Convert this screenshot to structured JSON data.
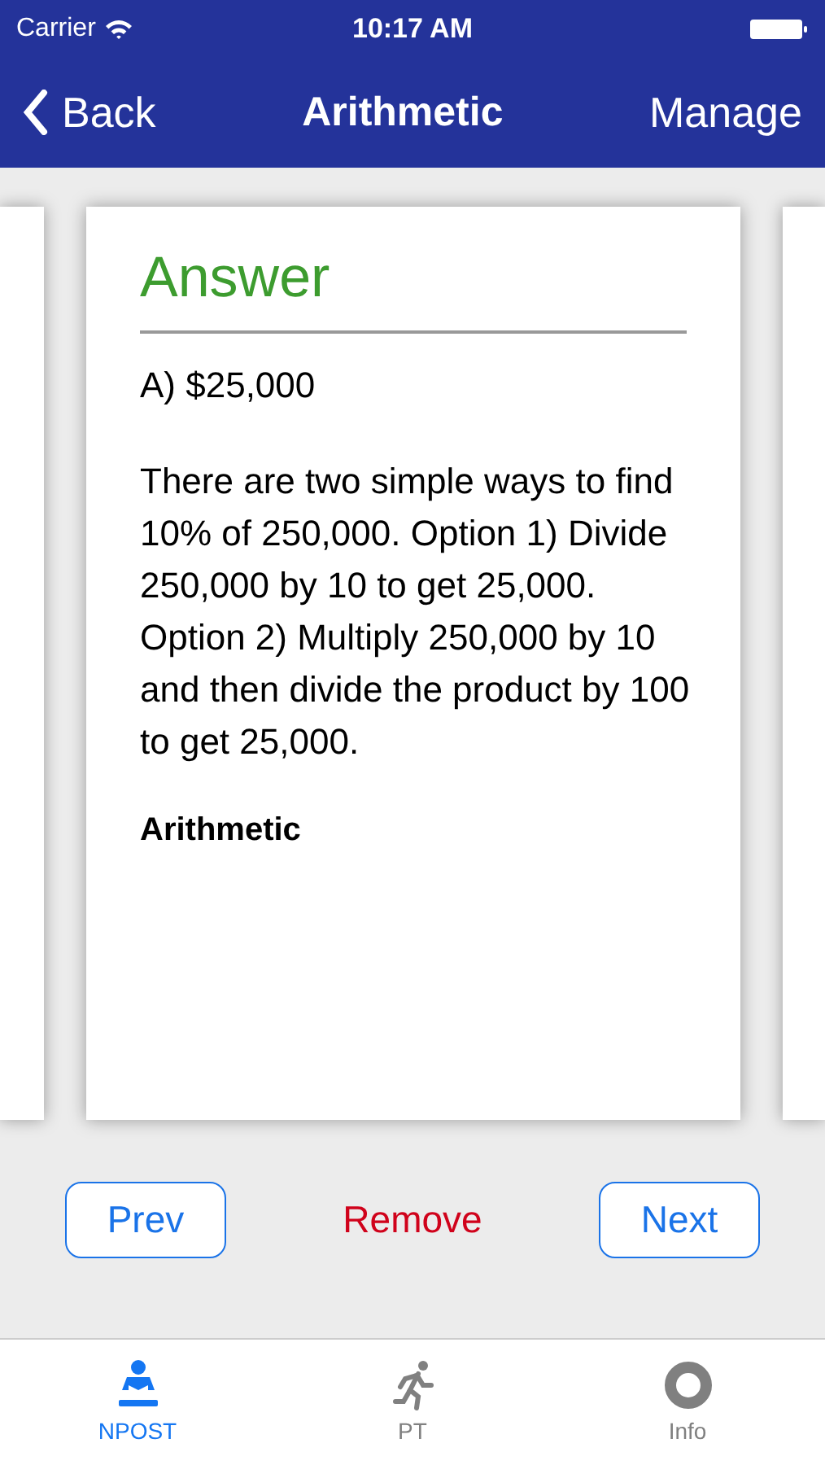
{
  "status_bar": {
    "carrier": "Carrier",
    "time": "10:17 AM"
  },
  "nav": {
    "back": "Back",
    "title": "Arithmetic",
    "action": "Manage"
  },
  "card": {
    "heading": "Answer",
    "answer": "A) $25,000",
    "explanation": "There are two simple ways to find 10% of 250,000. Option 1) Divide 250,000 by 10 to get 25,000. Option 2) Multiply 250,000 by 10 and then divide the product by 100 to get 25,000.",
    "category": "Arithmetic"
  },
  "actions": {
    "prev": "Prev",
    "remove": "Remove",
    "next": "Next"
  },
  "tabs": [
    {
      "label": "NPOST",
      "selected": true
    },
    {
      "label": "PT",
      "selected": false
    },
    {
      "label": "Info",
      "selected": false
    }
  ]
}
